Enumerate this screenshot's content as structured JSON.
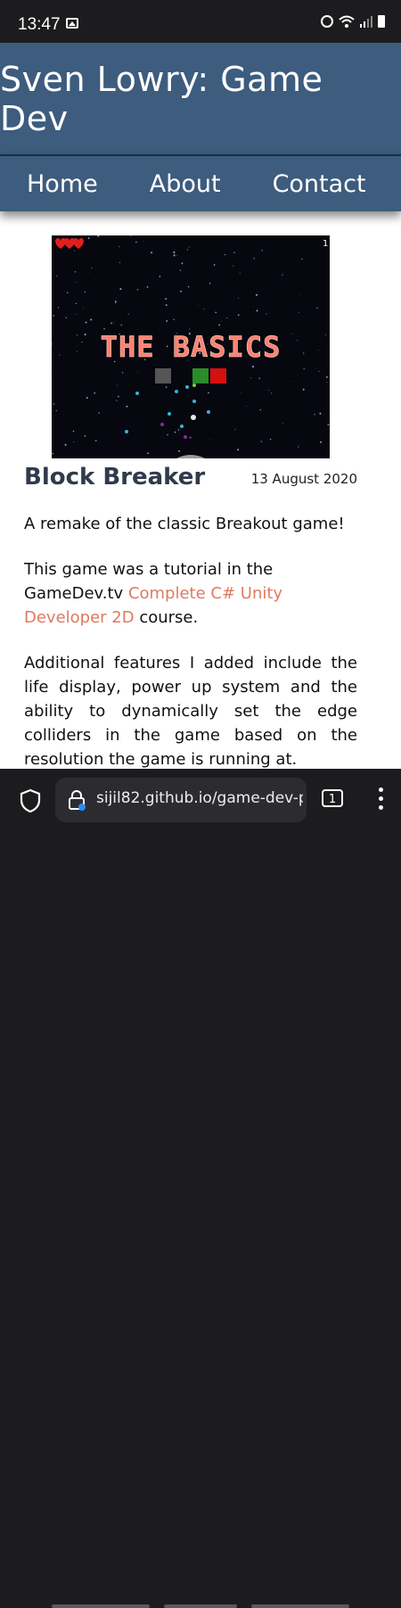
{
  "status_bar": {
    "time": "13:47"
  },
  "site": {
    "title": "Sven Lowry: Game Dev"
  },
  "nav": {
    "items": [
      "Home",
      "About",
      "Contact"
    ]
  },
  "hero": {
    "banner_text": "THE BASICS",
    "lives": 3,
    "counter": "1"
  },
  "post": {
    "title": "Block Breaker",
    "date": "13 August 2020",
    "para1": "A remake of the classic Breakout game!",
    "para2_prefix": "This game was a tutorial in the GameDev.tv ",
    "para2_link": "Complete C# Unity Developer 2D",
    "para2_suffix": " course.",
    "para3": "Additional features I added include the life display, power up system and the ability to dynamically set the edge colliders in the game based on the resolution the game is running at.",
    "link_color": "#e07a5f"
  },
  "browser": {
    "url": "sijil82.github.io/game-dev-p",
    "tab_count": "1"
  },
  "colors": {
    "header_bg": "#3d5c7e",
    "status_bg": "#1c1c1e"
  }
}
